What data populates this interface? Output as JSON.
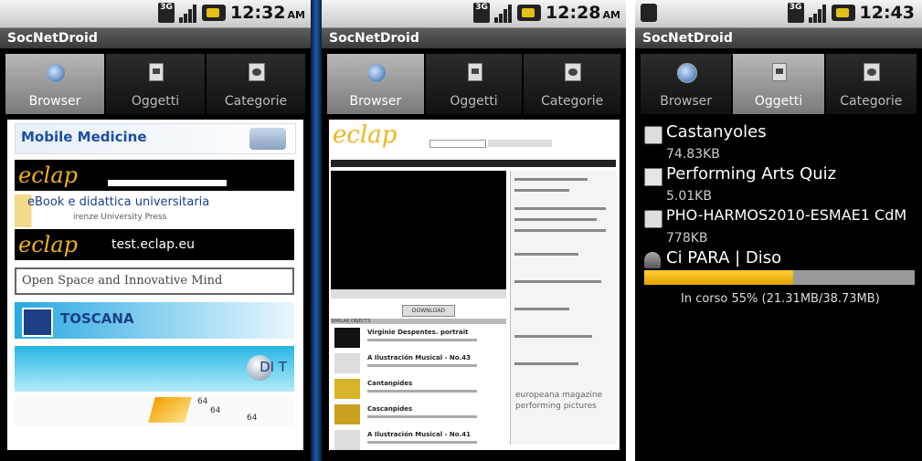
{
  "screens": [
    {
      "clock": "12:32",
      "ampm": "AM",
      "app_title": "SocNetDroid",
      "tabs": [
        {
          "label": "Browser",
          "icon": "globe-icon",
          "selected": true
        },
        {
          "label": "Oggetti",
          "icon": "document-icon",
          "selected": false
        },
        {
          "label": "Categorie",
          "icon": "category-icon",
          "selected": false
        }
      ],
      "bookmarks": {
        "mobile_medicine": "Mobile Medicine",
        "eclap": "eclap",
        "ebook": "eBook e didattica universitaria",
        "ebook_sub": "irenze University Press",
        "eclap_test_logo": "eclap",
        "eclap_test_url": "test.eclap.eu",
        "open_space": "Open Space and Innovative Mind",
        "toscana": "TOSCANA",
        "disit": "DI  T",
        "nums": [
          "64",
          "64",
          "64"
        ]
      }
    },
    {
      "clock": "12:28",
      "ampm": "AM",
      "app_title": "SocNetDroid",
      "tabs": [
        {
          "label": "Browser",
          "icon": "globe-icon",
          "selected": true
        },
        {
          "label": "Oggetti",
          "icon": "document-icon",
          "selected": false
        },
        {
          "label": "Categorie",
          "icon": "category-icon",
          "selected": false
        }
      ],
      "page": {
        "logo": "eclap",
        "download": "DOWNLOAD",
        "similar": "SIMILAR OBJECTS",
        "rows": [
          "Virginie Despentes. portrait",
          "A Ilustración Musical - No.43",
          "Cantanpides",
          "Cascanpides",
          "A Ilustración Musical - No.41"
        ],
        "tags": "europeana magazine performing pictures"
      }
    },
    {
      "clock": "12:43",
      "ampm": "",
      "app_title": "SocNetDroid",
      "tabs": [
        {
          "label": "Browser",
          "icon": "globe-icon",
          "selected": false
        },
        {
          "label": "Oggetti",
          "icon": "document-icon",
          "selected": true
        },
        {
          "label": "Categorie",
          "icon": "category-icon",
          "selected": false
        }
      ],
      "downloads": [
        {
          "name": "Castanyoles",
          "size": "74.83KB",
          "icon": "package-icon"
        },
        {
          "name": "Performing Arts Quiz",
          "size": "5.01KB",
          "icon": "document-icon"
        },
        {
          "name": "PHO-HARMOS2010-ESMAE1 CdM",
          "size": "778KB",
          "icon": "package-icon"
        },
        {
          "name": "Ci PARA | Diso",
          "size": "",
          "icon": "download-icon"
        }
      ],
      "progress_percent": 55,
      "progress_text": "In corso 55% (21.31MB/38.73MB)"
    }
  ]
}
